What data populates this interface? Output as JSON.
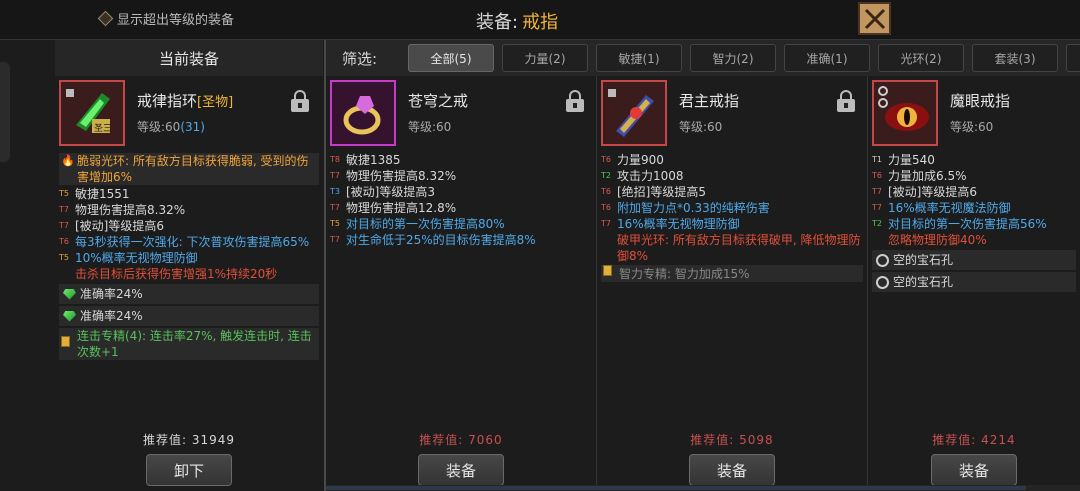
{
  "header": {
    "show_toggle_label": "显示超出等级的装备",
    "title_prefix": "装备:",
    "title_value": "戒指",
    "close_icon": "close-x-icon"
  },
  "current": {
    "header": "当前装备",
    "name": "戒律指环",
    "tag": "[圣物]",
    "level_label": "等级:60",
    "level_bonus": "(31)",
    "thumb_badge": "圣三",
    "set_effect": "脆弱光环: 所有敌方目标获得脆弱, 受到的伤害增加6%",
    "stats": [
      {
        "tier": "T5",
        "text": "敏捷1551",
        "color": ""
      },
      {
        "tier": "T7",
        "text": "物理伤害提高8.32%",
        "color": ""
      },
      {
        "tier": "T7",
        "text": "[被动]等级提高6",
        "color": ""
      },
      {
        "tier": "T6",
        "text": "每3秒获得一次强化: 下次普攻伤害提高65%",
        "color": "blue"
      },
      {
        "tier": "T5",
        "text": "10%概率无视物理防御",
        "color": "blue"
      },
      {
        "tier": "",
        "text": "击杀目标后获得伤害增强1%持续20秒",
        "color": "red"
      }
    ],
    "gems": [
      "准确率24%",
      "准确率24%"
    ],
    "mastery": "连击专精(4): 连击率27%, 触发连击时, 连击次数+1",
    "recommend": "推荐值: 31949",
    "action": "卸下"
  },
  "filter": {
    "label": "筛选:",
    "buttons": [
      "全部(5)",
      "力量(2)",
      "敏捷(1)",
      "智力(2)",
      "准确(1)",
      "光环(2)",
      "套装(3)"
    ]
  },
  "candidates": [
    {
      "name": "苍穹之戒",
      "level_label": "等级:60",
      "stats": [
        {
          "tier": "T8",
          "text": "敏捷1385",
          "color": ""
        },
        {
          "tier": "T7",
          "text": "物理伤害提高8.32%",
          "color": ""
        },
        {
          "tier": "T3",
          "text": "[被动]等级提高3",
          "color": ""
        },
        {
          "tier": "T7",
          "text": "物理伤害提高12.8%",
          "color": ""
        },
        {
          "tier": "T5",
          "text": "对目标的第一次伤害提高80%",
          "color": "blue"
        },
        {
          "tier": "T7",
          "text": "对生命低于25%的目标伤害提高8%",
          "color": "blue"
        }
      ],
      "recommend": "推荐值: 7060",
      "action": "装备"
    },
    {
      "name": "君主戒指",
      "level_label": "等级:60",
      "stats": [
        {
          "tier": "T6",
          "text": "力量900",
          "color": ""
        },
        {
          "tier": "T2",
          "text": "攻击力1008",
          "color": ""
        },
        {
          "tier": "T6",
          "text": "[绝招]等级提高5",
          "color": ""
        },
        {
          "tier": "T6",
          "text": "附加智力点*0.33的纯粹伤害",
          "color": "blue"
        },
        {
          "tier": "T7",
          "text": "16%概率无视物理防御",
          "color": "blue"
        },
        {
          "tier": "",
          "text": "破甲光环: 所有敌方目标获得破甲, 降低物理防御8%",
          "color": "red"
        }
      ],
      "mastery": "智力专精: 智力加成15%",
      "recommend": "推荐值: 5098",
      "action": "装备"
    },
    {
      "name": "魔眼戒指",
      "level_label": "等级:60",
      "stats": [
        {
          "tier": "T1",
          "text": "力量540",
          "color": ""
        },
        {
          "tier": "T6",
          "text": "力量加成6.5%",
          "color": ""
        },
        {
          "tier": "T7",
          "text": "[被动]等级提高6",
          "color": ""
        },
        {
          "tier": "T7",
          "text": "16%概率无视魔法防御",
          "color": "blue"
        },
        {
          "tier": "T2",
          "text": "对目标的第一次伤害提高56%",
          "color": "blue"
        },
        {
          "tier": "",
          "text": "忽略物理防御40%",
          "color": "red"
        }
      ],
      "sockets": [
        "空的宝石孔",
        "空的宝石孔"
      ],
      "recommend": "推荐值: 4214",
      "action": "装备"
    }
  ]
}
